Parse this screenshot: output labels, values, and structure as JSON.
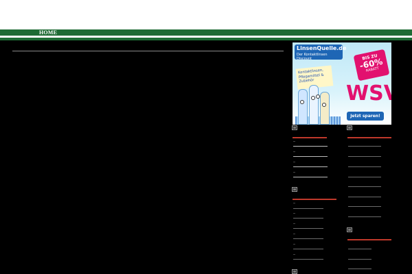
{
  "nav": {
    "home_label": "HOME"
  },
  "colors": {
    "nav_green": "#1e6b34",
    "background": "#000000",
    "widget_accent": "#c0392b",
    "ad_pink": "#e2116f",
    "ad_blue": "#1e66b5"
  },
  "ad": {
    "brand": "LinsenQuelle.de",
    "tagline": "Der Kontaktlinsen Discount",
    "badge_top": "BIS ZU",
    "badge_value": "-60%",
    "badge_bottom": "RABATT",
    "note": "Kontaktlinsen, Pflegemittel & Zubehör",
    "headline": "WSV",
    "cta": "Jetzt sparen!"
  },
  "icons": {
    "widget_icon": "broken-image-icon"
  }
}
